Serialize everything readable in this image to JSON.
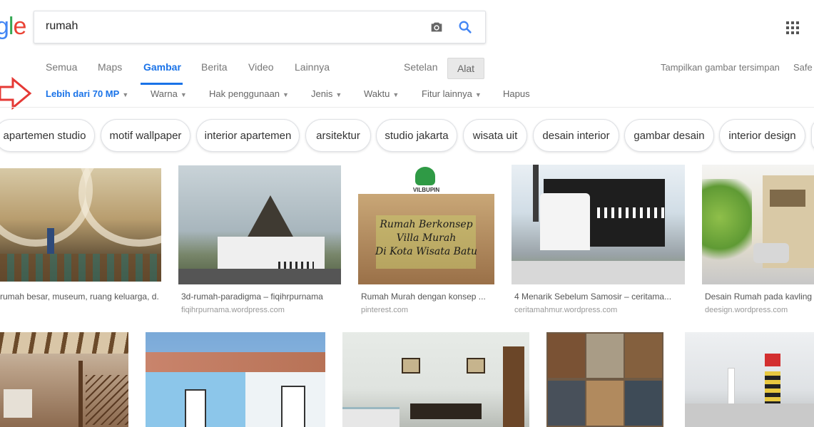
{
  "logo": {
    "g": "g",
    "l": "l",
    "e": "e"
  },
  "search": {
    "query": "rumah"
  },
  "icons": {
    "camera": "camera-icon",
    "search": "search-icon",
    "apps": "apps-grid-icon"
  },
  "tabs": [
    "Semua",
    "Maps",
    "Gambar",
    "Berita",
    "Video",
    "Lainnya",
    "Setelan"
  ],
  "tools_label": "Alat",
  "right_links": {
    "saved": "Tampilkan gambar tersimpan",
    "safe": "Safe"
  },
  "filters": [
    "Lebih dari 70 MP",
    "Warna",
    "Hak penggunaan",
    "Jenis",
    "Waktu",
    "Fitur lainnya",
    "Hapus"
  ],
  "chips": [
    "apartemen studio",
    "motif wallpaper",
    "interior apartemen",
    "arsitektur",
    "studio jakarta",
    "wisata uit",
    "desain interior",
    "gambar desain",
    "interior design"
  ],
  "results_row1": [
    {
      "title": "rumah besar, museum, ruang keluarga, d...",
      "source": ""
    },
    {
      "title": "3d-rumah-paradigma – fiqihrpurnama",
      "source": "fiqihrpurnama.wordpress.com"
    },
    {
      "title": "Rumah Murah dengan konsep ...",
      "source": "pinterest.com"
    },
    {
      "title": "4 Menarik Sebelum Samosir – ceritama...",
      "source": "ceritamahmur.wordpress.com"
    },
    {
      "title": "Desain Rumah pada kavling ...",
      "source": "deesign.wordpress.com"
    }
  ],
  "overlay": {
    "brand": "VILBUPIN",
    "line1": "Rumah Berkonsep",
    "line2": "Villa Murah",
    "line3": "Di Kota Wisata Batu"
  },
  "colors": {
    "accent": "#1a73e8",
    "arrow": "#e53935"
  }
}
